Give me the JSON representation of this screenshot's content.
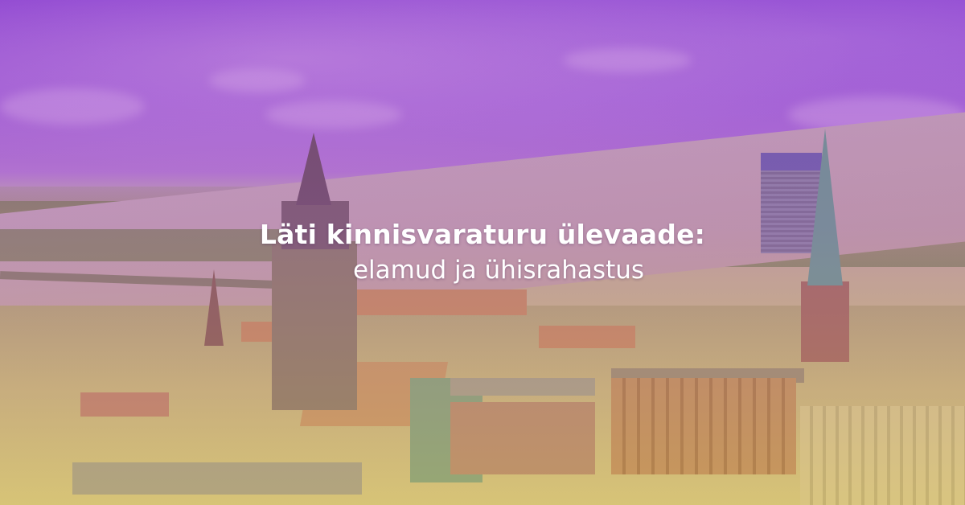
{
  "headline": {
    "title": "Läti kinnisvaraturu ülevaade:",
    "subtitle": "elamud ja ühisrahastus"
  },
  "background": {
    "overlay_color": "#8a3fd1",
    "accent_color": "#d1c17a"
  }
}
